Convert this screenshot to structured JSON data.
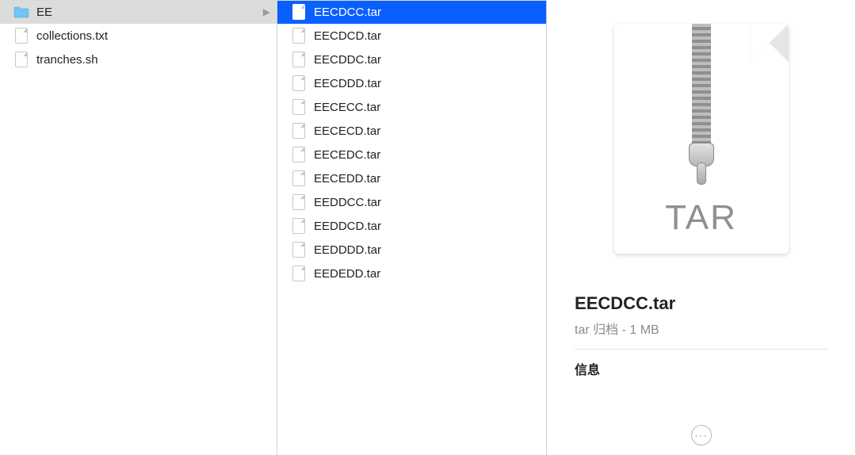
{
  "col1": {
    "items": [
      {
        "name": "EE",
        "type": "folder",
        "selected": true,
        "hasChildren": true
      },
      {
        "name": "collections.txt",
        "type": "file",
        "selected": false
      },
      {
        "name": "tranches.sh",
        "type": "file",
        "selected": false
      }
    ]
  },
  "col2": {
    "items": [
      {
        "name": "EECDCC.tar",
        "type": "file",
        "selected": true
      },
      {
        "name": "EECDCD.tar",
        "type": "file",
        "selected": false
      },
      {
        "name": "EECDDC.tar",
        "type": "file",
        "selected": false
      },
      {
        "name": "EECDDD.tar",
        "type": "file",
        "selected": false
      },
      {
        "name": "EECECC.tar",
        "type": "file",
        "selected": false
      },
      {
        "name": "EECECD.tar",
        "type": "file",
        "selected": false
      },
      {
        "name": "EECEDC.tar",
        "type": "file",
        "selected": false
      },
      {
        "name": "EECEDD.tar",
        "type": "file",
        "selected": false
      },
      {
        "name": "EEDDCC.tar",
        "type": "file",
        "selected": false
      },
      {
        "name": "EEDDCD.tar",
        "type": "file",
        "selected": false
      },
      {
        "name": "EEDDDD.tar",
        "type": "file",
        "selected": false
      },
      {
        "name": "EEDEDD.tar",
        "type": "file",
        "selected": false
      }
    ]
  },
  "preview": {
    "ext_label": "TAR",
    "filename": "EECDCC.tar",
    "kind_size": "tar 归档 - 1 MB",
    "section_label": "信息"
  },
  "colors": {
    "selection_blue": "#0a60ff",
    "selection_gray": "#dcdcdc"
  }
}
